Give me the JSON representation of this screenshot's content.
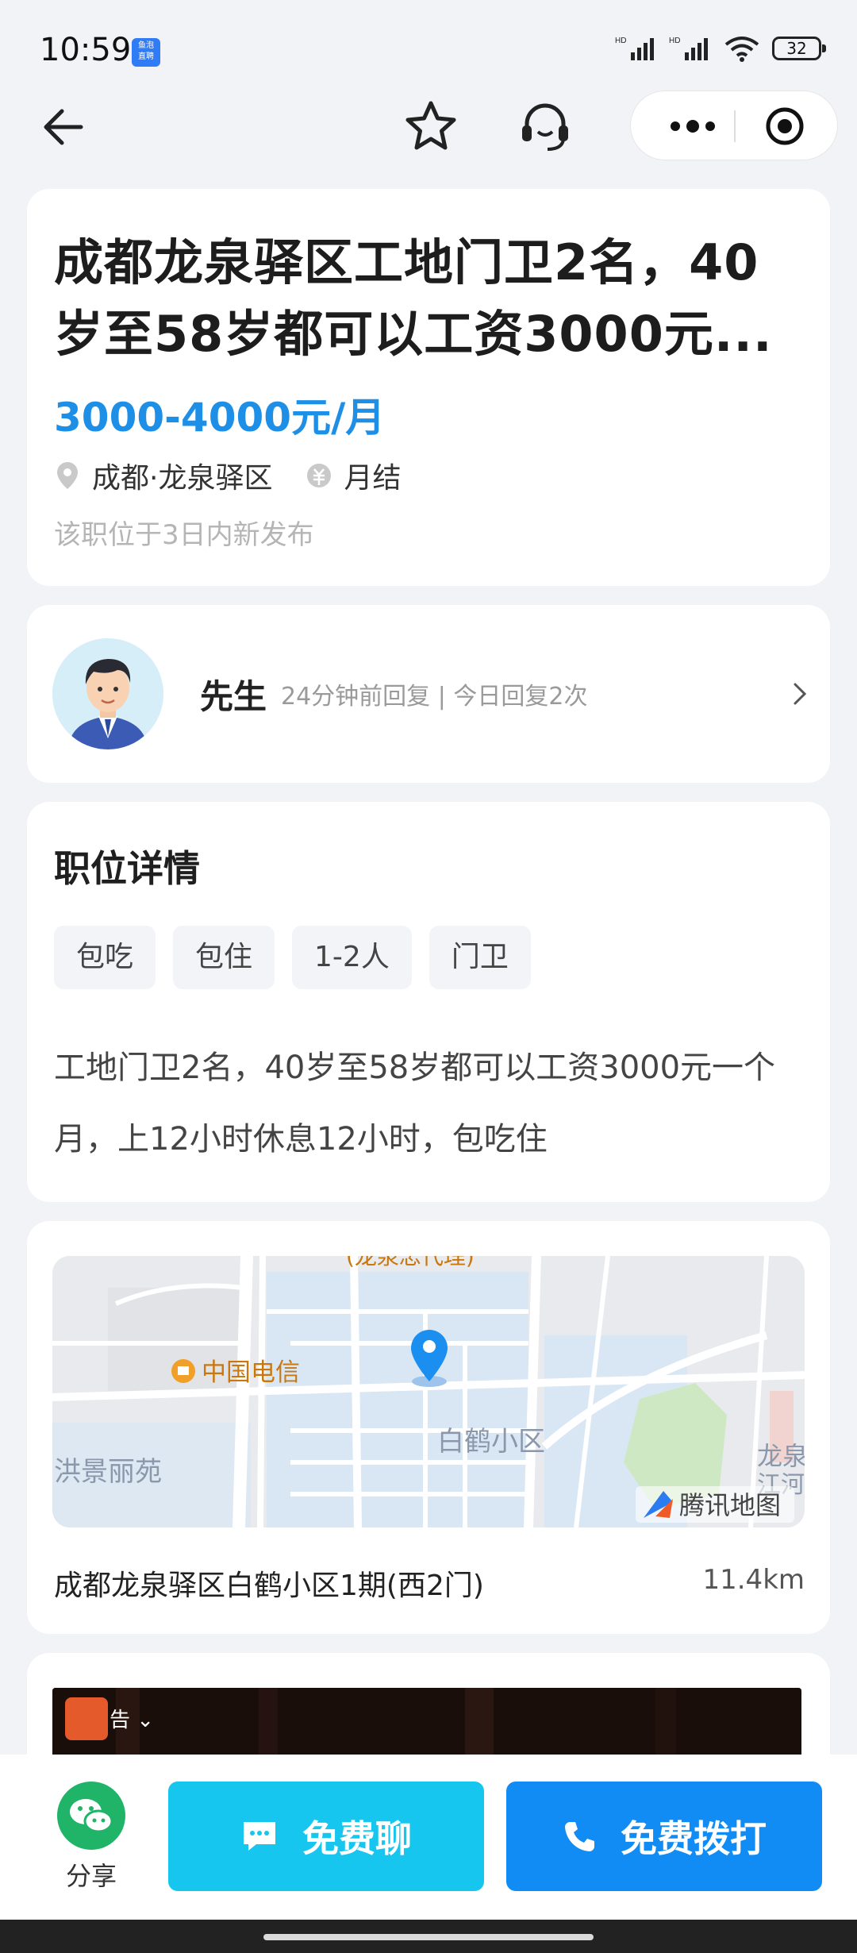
{
  "status_bar": {
    "time": "10:59",
    "badge_line1": "鱼泡",
    "badge_line2": "直聘",
    "battery": "32"
  },
  "job": {
    "title": "成都龙泉驿区工地门卫2名，40岁至58岁都可以工资3000元...",
    "salary": "3000-4000元/月",
    "location": "成都·龙泉驿区",
    "settlement": "月结",
    "posted": "该职位于3日内新发布"
  },
  "recruiter": {
    "name": "先生",
    "reply_info": "24分钟前回复 | 今日回复2次"
  },
  "details": {
    "section_title": "职位详情",
    "tags": [
      "包吃",
      "包住",
      "1-2人",
      "门卫"
    ],
    "description": "工地门卫2名，40岁至58岁都可以工资3000元一个月，上12小时休息12小时，包吃住"
  },
  "map": {
    "labels": {
      "telecom": "中国电信",
      "baihe": "白鹤小区",
      "hongjing": "洪景丽苑",
      "longquan": "龙泉",
      "river": "江河",
      "top": "(龙泉忠代理)",
      "provider": "腾讯地图"
    },
    "address": "成都龙泉驿区白鹤小区1期(西2门)",
    "distance": "11.4km"
  },
  "ad": {
    "label": "告"
  },
  "bottom": {
    "share": "分享",
    "chat": "免费聊",
    "call": "免费拨打"
  },
  "colors": {
    "salary": "#1e8fe6",
    "chat_button": "#16c6ee",
    "call_button": "#128cf5",
    "share_icon": "#1fb468",
    "map_pin": "#1a8ff0"
  }
}
